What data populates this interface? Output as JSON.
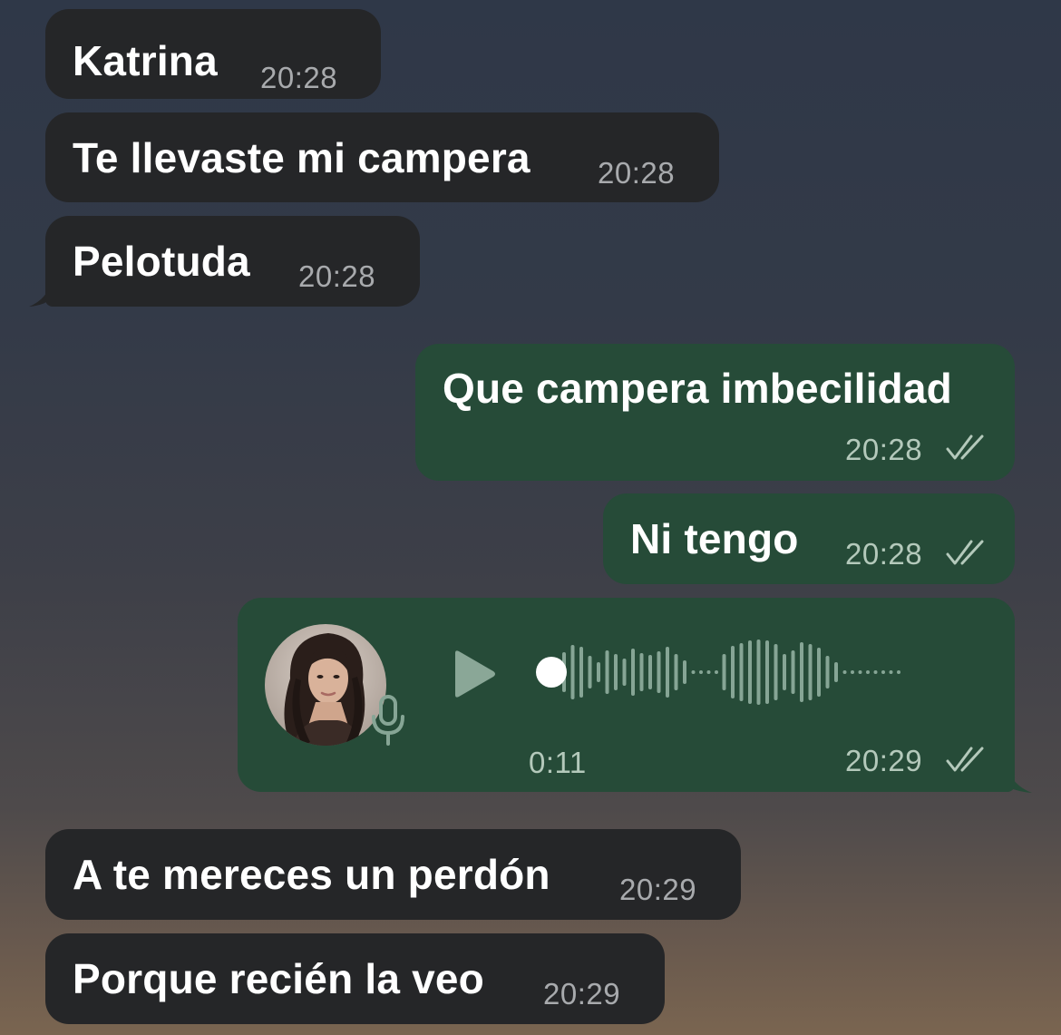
{
  "messages": [
    {
      "direction": "incoming",
      "text": "Katrina",
      "time": "20:28"
    },
    {
      "direction": "incoming",
      "text": "Te llevaste mi campera",
      "time": "20:28"
    },
    {
      "direction": "incoming",
      "text": "Pelotuda",
      "time": "20:28"
    },
    {
      "direction": "outgoing",
      "text": "Que campera imbecilidad",
      "time": "20:28",
      "status": "read"
    },
    {
      "direction": "outgoing",
      "text": "Ni tengo",
      "time": "20:28",
      "status": "read"
    },
    {
      "direction": "outgoing",
      "type": "voice",
      "duration": "0:11",
      "time": "20:29",
      "status": "read",
      "progress": 0
    },
    {
      "direction": "incoming",
      "text": "A te mereces un perdón",
      "time": "20:29"
    },
    {
      "direction": "incoming",
      "text": "Porque recién la veo",
      "time": "20:29"
    }
  ],
  "icons": {
    "read_status": "double-check-icon",
    "play": "play-icon",
    "mic": "microphone-icon",
    "avatar": "contact-avatar"
  },
  "colors": {
    "incoming_bubble": "#252628",
    "outgoing_bubble": "#264b38",
    "timestamp_incoming": "#a8aaad",
    "timestamp_outgoing": "#b4c9bb",
    "waveform": "#86a595",
    "waveform_dot": "#ffffff"
  }
}
